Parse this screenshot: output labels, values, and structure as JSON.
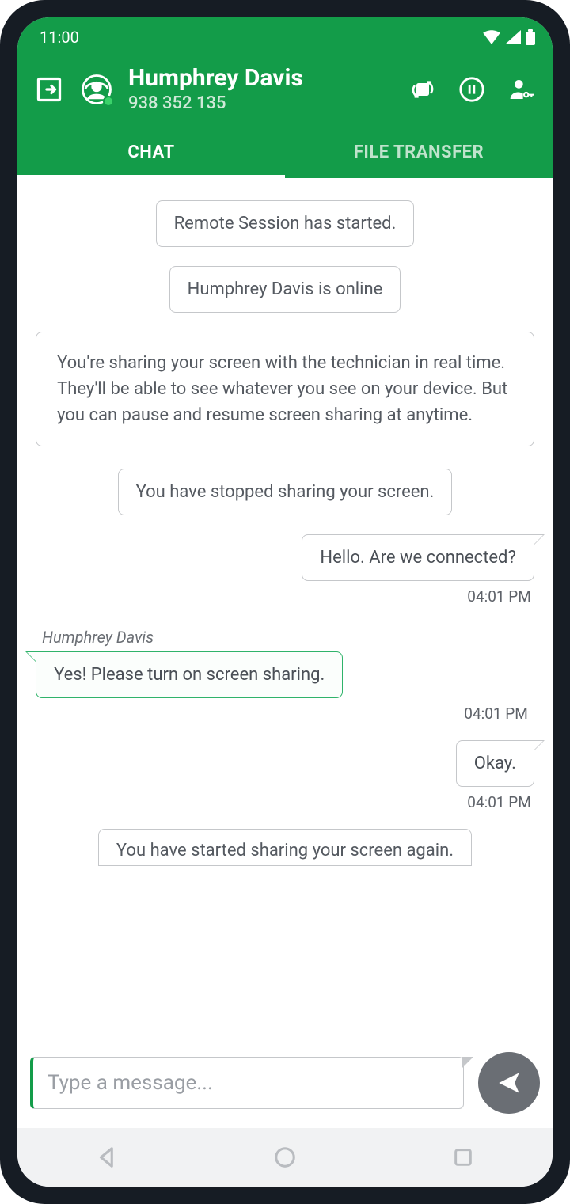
{
  "status_bar": {
    "time": "11:00"
  },
  "header": {
    "name": "Humphrey Davis",
    "session_id": "938 352 135"
  },
  "tabs": {
    "chat": "CHAT",
    "file_transfer": "FILE TRANSFER"
  },
  "system_messages": {
    "session_started": "Remote Session has started.",
    "user_online": "Humphrey Davis is online",
    "sharing_notice": "You're sharing your screen with the technician in real time. They'll be able to see whatever you see on your device. But you can pause and resume screen sharing at anytime.",
    "sharing_stopped": "You have stopped sharing your screen.",
    "sharing_resumed": "You have started sharing your screen again."
  },
  "messages": [
    {
      "direction": "out",
      "text": "Hello. Are we connected?",
      "time": "04:01 PM"
    },
    {
      "direction": "in",
      "sender": "Humphrey Davis",
      "text": "Yes! Please turn on screen sharing.",
      "time": "04:01 PM"
    },
    {
      "direction": "out",
      "text": "Okay.",
      "time": "04:01 PM"
    }
  ],
  "composer": {
    "placeholder": "Type a message..."
  }
}
